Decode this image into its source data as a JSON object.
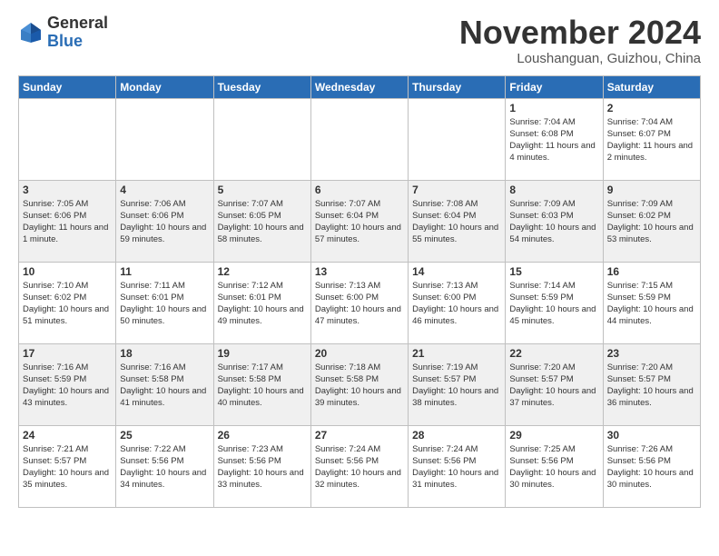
{
  "header": {
    "logo_general": "General",
    "logo_blue": "Blue",
    "month_title": "November 2024",
    "location": "Loushanguan, Guizhou, China"
  },
  "days_of_week": [
    "Sunday",
    "Monday",
    "Tuesday",
    "Wednesday",
    "Thursday",
    "Friday",
    "Saturday"
  ],
  "weeks": [
    [
      {
        "day": "",
        "info": ""
      },
      {
        "day": "",
        "info": ""
      },
      {
        "day": "",
        "info": ""
      },
      {
        "day": "",
        "info": ""
      },
      {
        "day": "",
        "info": ""
      },
      {
        "day": "1",
        "info": "Sunrise: 7:04 AM\nSunset: 6:08 PM\nDaylight: 11 hours and 4 minutes."
      },
      {
        "day": "2",
        "info": "Sunrise: 7:04 AM\nSunset: 6:07 PM\nDaylight: 11 hours and 2 minutes."
      }
    ],
    [
      {
        "day": "3",
        "info": "Sunrise: 7:05 AM\nSunset: 6:06 PM\nDaylight: 11 hours and 1 minute."
      },
      {
        "day": "4",
        "info": "Sunrise: 7:06 AM\nSunset: 6:06 PM\nDaylight: 10 hours and 59 minutes."
      },
      {
        "day": "5",
        "info": "Sunrise: 7:07 AM\nSunset: 6:05 PM\nDaylight: 10 hours and 58 minutes."
      },
      {
        "day": "6",
        "info": "Sunrise: 7:07 AM\nSunset: 6:04 PM\nDaylight: 10 hours and 57 minutes."
      },
      {
        "day": "7",
        "info": "Sunrise: 7:08 AM\nSunset: 6:04 PM\nDaylight: 10 hours and 55 minutes."
      },
      {
        "day": "8",
        "info": "Sunrise: 7:09 AM\nSunset: 6:03 PM\nDaylight: 10 hours and 54 minutes."
      },
      {
        "day": "9",
        "info": "Sunrise: 7:09 AM\nSunset: 6:02 PM\nDaylight: 10 hours and 53 minutes."
      }
    ],
    [
      {
        "day": "10",
        "info": "Sunrise: 7:10 AM\nSunset: 6:02 PM\nDaylight: 10 hours and 51 minutes."
      },
      {
        "day": "11",
        "info": "Sunrise: 7:11 AM\nSunset: 6:01 PM\nDaylight: 10 hours and 50 minutes."
      },
      {
        "day": "12",
        "info": "Sunrise: 7:12 AM\nSunset: 6:01 PM\nDaylight: 10 hours and 49 minutes."
      },
      {
        "day": "13",
        "info": "Sunrise: 7:13 AM\nSunset: 6:00 PM\nDaylight: 10 hours and 47 minutes."
      },
      {
        "day": "14",
        "info": "Sunrise: 7:13 AM\nSunset: 6:00 PM\nDaylight: 10 hours and 46 minutes."
      },
      {
        "day": "15",
        "info": "Sunrise: 7:14 AM\nSunset: 5:59 PM\nDaylight: 10 hours and 45 minutes."
      },
      {
        "day": "16",
        "info": "Sunrise: 7:15 AM\nSunset: 5:59 PM\nDaylight: 10 hours and 44 minutes."
      }
    ],
    [
      {
        "day": "17",
        "info": "Sunrise: 7:16 AM\nSunset: 5:59 PM\nDaylight: 10 hours and 43 minutes."
      },
      {
        "day": "18",
        "info": "Sunrise: 7:16 AM\nSunset: 5:58 PM\nDaylight: 10 hours and 41 minutes."
      },
      {
        "day": "19",
        "info": "Sunrise: 7:17 AM\nSunset: 5:58 PM\nDaylight: 10 hours and 40 minutes."
      },
      {
        "day": "20",
        "info": "Sunrise: 7:18 AM\nSunset: 5:58 PM\nDaylight: 10 hours and 39 minutes."
      },
      {
        "day": "21",
        "info": "Sunrise: 7:19 AM\nSunset: 5:57 PM\nDaylight: 10 hours and 38 minutes."
      },
      {
        "day": "22",
        "info": "Sunrise: 7:20 AM\nSunset: 5:57 PM\nDaylight: 10 hours and 37 minutes."
      },
      {
        "day": "23",
        "info": "Sunrise: 7:20 AM\nSunset: 5:57 PM\nDaylight: 10 hours and 36 minutes."
      }
    ],
    [
      {
        "day": "24",
        "info": "Sunrise: 7:21 AM\nSunset: 5:57 PM\nDaylight: 10 hours and 35 minutes."
      },
      {
        "day": "25",
        "info": "Sunrise: 7:22 AM\nSunset: 5:56 PM\nDaylight: 10 hours and 34 minutes."
      },
      {
        "day": "26",
        "info": "Sunrise: 7:23 AM\nSunset: 5:56 PM\nDaylight: 10 hours and 33 minutes."
      },
      {
        "day": "27",
        "info": "Sunrise: 7:24 AM\nSunset: 5:56 PM\nDaylight: 10 hours and 32 minutes."
      },
      {
        "day": "28",
        "info": "Sunrise: 7:24 AM\nSunset: 5:56 PM\nDaylight: 10 hours and 31 minutes."
      },
      {
        "day": "29",
        "info": "Sunrise: 7:25 AM\nSunset: 5:56 PM\nDaylight: 10 hours and 30 minutes."
      },
      {
        "day": "30",
        "info": "Sunrise: 7:26 AM\nSunset: 5:56 PM\nDaylight: 10 hours and 30 minutes."
      }
    ]
  ]
}
